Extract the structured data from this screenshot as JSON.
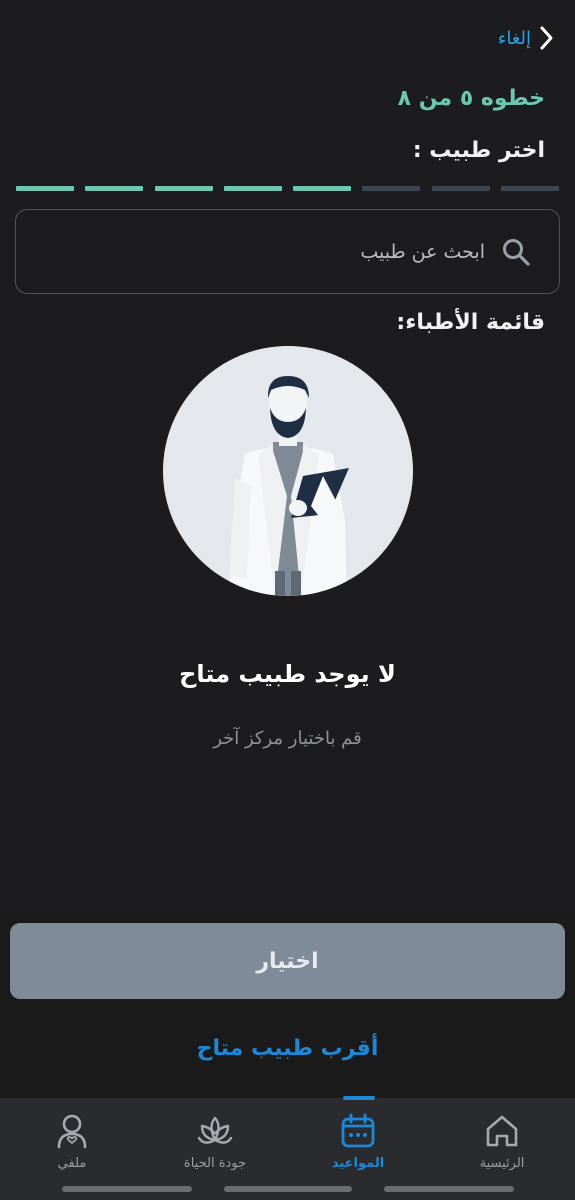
{
  "header": {
    "cancel_label": "إلغاء",
    "cancel_icon": "chevron-back-icon",
    "step_label": "خطوه ٥ من ٨",
    "choose_label": "اختر طبيب :"
  },
  "progress": {
    "total_steps": 8,
    "completed_steps": 5,
    "done_color": "#6cc6b0",
    "todo_color": "#3d4651"
  },
  "search": {
    "placeholder": "ابحث عن طبيب",
    "value": "",
    "icon": "search-icon"
  },
  "list": {
    "title": "قائمة الأطباء:"
  },
  "empty_state": {
    "illustration": "doctor-avatar-illustration",
    "title": "لا يوجد طبيب متاح",
    "subtitle": "قم باختيار مركز آخر"
  },
  "actions": {
    "select_label": "اختيار",
    "nearest_label": "أقرب طبيب متاح"
  },
  "tabbar": {
    "items": [
      {
        "label": "الرئيسية",
        "icon": "home-icon",
        "active": false
      },
      {
        "label": "المواعيد",
        "icon": "calendar-icon",
        "active": true
      },
      {
        "label": "جودة الحياة",
        "icon": "lotus-icon",
        "active": false
      },
      {
        "label": "ملفي",
        "icon": "profile-icon",
        "active": false
      }
    ]
  },
  "colors": {
    "background": "#1c1c1e",
    "accent_teal": "#6cc6b0",
    "accent_blue": "#1e88d6",
    "button_disabled": "#808b99"
  }
}
